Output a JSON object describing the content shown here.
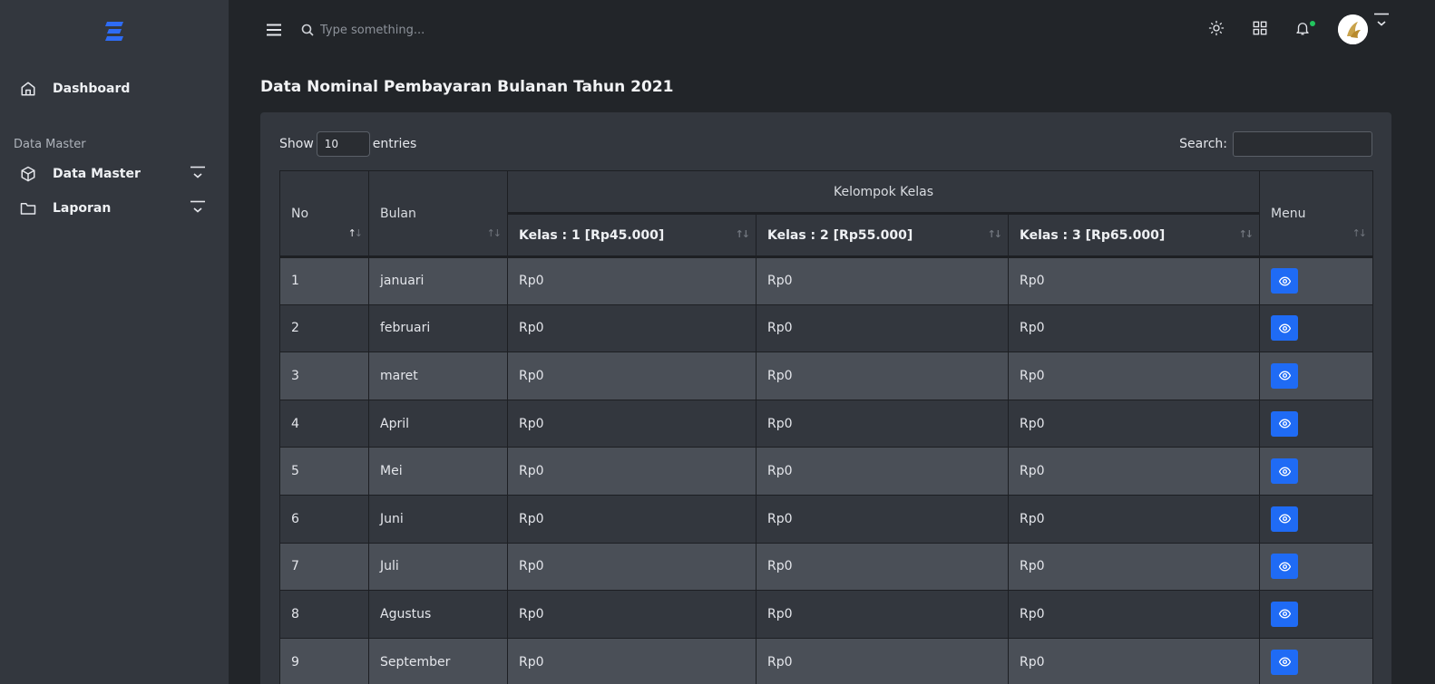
{
  "sidebar": {
    "items": [
      {
        "label": "Dashboard",
        "icon": "home-icon"
      },
      {
        "label": "Data Master",
        "icon": "cube-icon"
      },
      {
        "label": "Laporan",
        "icon": "folder-icon"
      }
    ],
    "section_label": "Data Master"
  },
  "topbar": {
    "search_placeholder": "Type something..."
  },
  "page": {
    "title": "Data Nominal Pembayaran Bulanan Tahun 2021"
  },
  "table_controls": {
    "show_label": "Show",
    "page_length": "10",
    "entries_label": "entries",
    "search_label": "Search:"
  },
  "table": {
    "headers": {
      "no": "No",
      "bulan": "Bulan",
      "group": "Kelompok Kelas",
      "kelas1": "Kelas : 1 [Rp45.000]",
      "kelas2": "Kelas : 2 [Rp55.000]",
      "kelas3": "Kelas : 3 [Rp65.000]",
      "menu": "Menu"
    },
    "rows": [
      {
        "no": "1",
        "bulan": "januari",
        "k1": "Rp0",
        "k2": "Rp0",
        "k3": "Rp0"
      },
      {
        "no": "2",
        "bulan": "februari",
        "k1": "Rp0",
        "k2": "Rp0",
        "k3": "Rp0"
      },
      {
        "no": "3",
        "bulan": "maret",
        "k1": "Rp0",
        "k2": "Rp0",
        "k3": "Rp0"
      },
      {
        "no": "4",
        "bulan": "April",
        "k1": "Rp0",
        "k2": "Rp0",
        "k3": "Rp0"
      },
      {
        "no": "5",
        "bulan": "Mei",
        "k1": "Rp0",
        "k2": "Rp0",
        "k3": "Rp0"
      },
      {
        "no": "6",
        "bulan": "Juni",
        "k1": "Rp0",
        "k2": "Rp0",
        "k3": "Rp0"
      },
      {
        "no": "7",
        "bulan": "Juli",
        "k1": "Rp0",
        "k2": "Rp0",
        "k3": "Rp0"
      },
      {
        "no": "8",
        "bulan": "Agustus",
        "k1": "Rp0",
        "k2": "Rp0",
        "k3": "Rp0"
      },
      {
        "no": "9",
        "bulan": "September",
        "k1": "Rp0",
        "k2": "Rp0",
        "k3": "Rp0"
      }
    ]
  },
  "colors": {
    "accent": "#1f6bf5",
    "sidebar_bg": "#33373e",
    "page_bg": "#222529",
    "online_dot": "#22c55e"
  }
}
